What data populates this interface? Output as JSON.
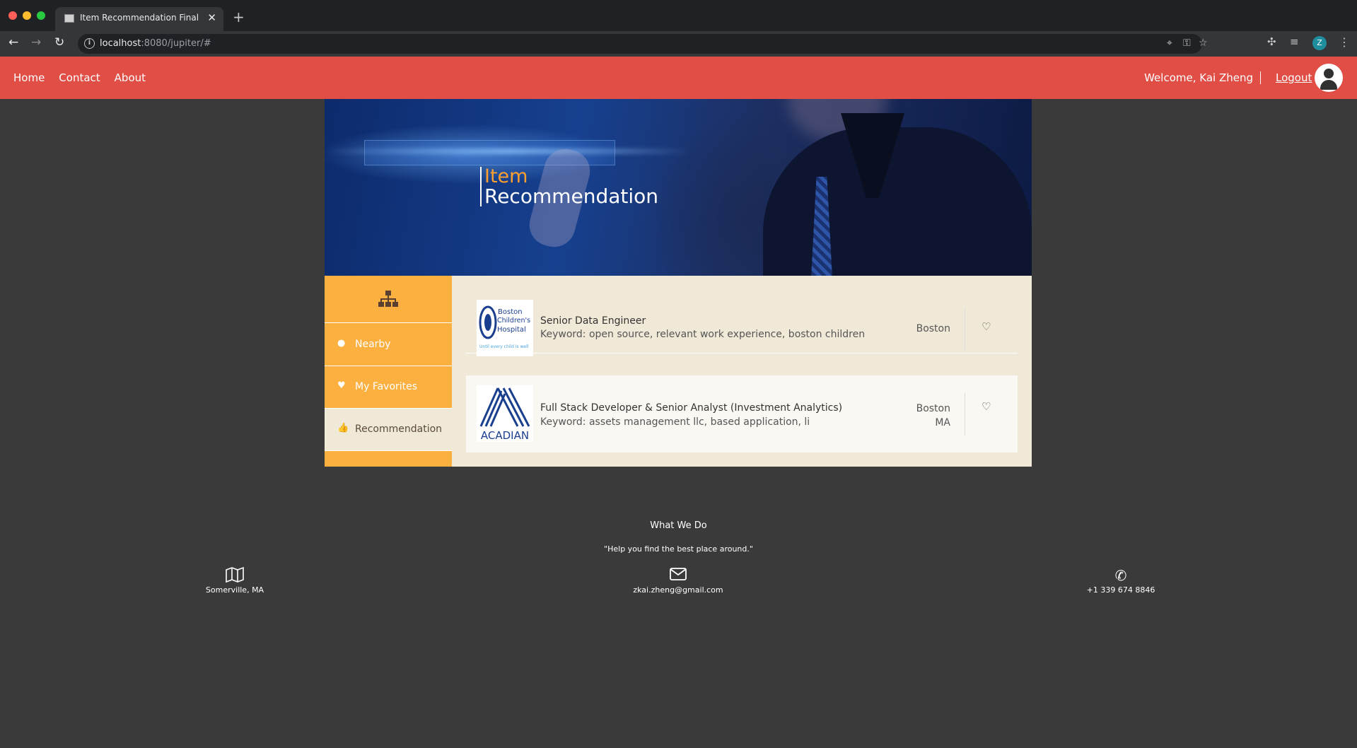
{
  "browser": {
    "tab_title": "Item Recommendation Final",
    "url_host": "localhost",
    "url_rest": ":8080/jupiter/#",
    "profile_initial": "Z"
  },
  "header": {
    "nav": [
      "Home",
      "Contact",
      "About"
    ],
    "welcome": "Welcome, Kai Zheng",
    "logout": "Logout"
  },
  "hero": {
    "title_line1": "Item",
    "title_line2": "Recommendation"
  },
  "sidebar": {
    "items": [
      {
        "label": "Nearby",
        "icon": "map-pin-icon"
      },
      {
        "label": "My Favorites",
        "icon": "heart-icon"
      },
      {
        "label": "Recommendation",
        "icon": "thumbs-up-icon",
        "active": true
      }
    ]
  },
  "items": [
    {
      "title": "Senior Data Engineer",
      "keywords": "Keyword: open source, relevant work experience, boston children",
      "location_line1": "Boston",
      "location_line2": "",
      "logo_text": "Boston Children's Hospital",
      "logo_tagline": "Until every child is well",
      "favorited": false
    },
    {
      "title": "Full Stack Developer & Senior Analyst (Investment Analytics)",
      "keywords": "Keyword: assets management llc, based application, li",
      "location_line1": "Boston",
      "location_line2": "MA",
      "logo_text": "ACADIAN",
      "favorited": false
    }
  ],
  "footer": {
    "heading": "What We Do",
    "quote": "\"Help you find the best place around.\"",
    "location": "Somerville, MA",
    "email": "zkai.zheng@gmail.com",
    "phone": "+1 339 674 8846"
  },
  "colors": {
    "header_bg": "#e04e46",
    "sidebar_bg": "#fbb040",
    "content_bg": "#f1e9d8",
    "hero_accent": "#ff9f30",
    "page_bg": "#3a3a3a"
  }
}
